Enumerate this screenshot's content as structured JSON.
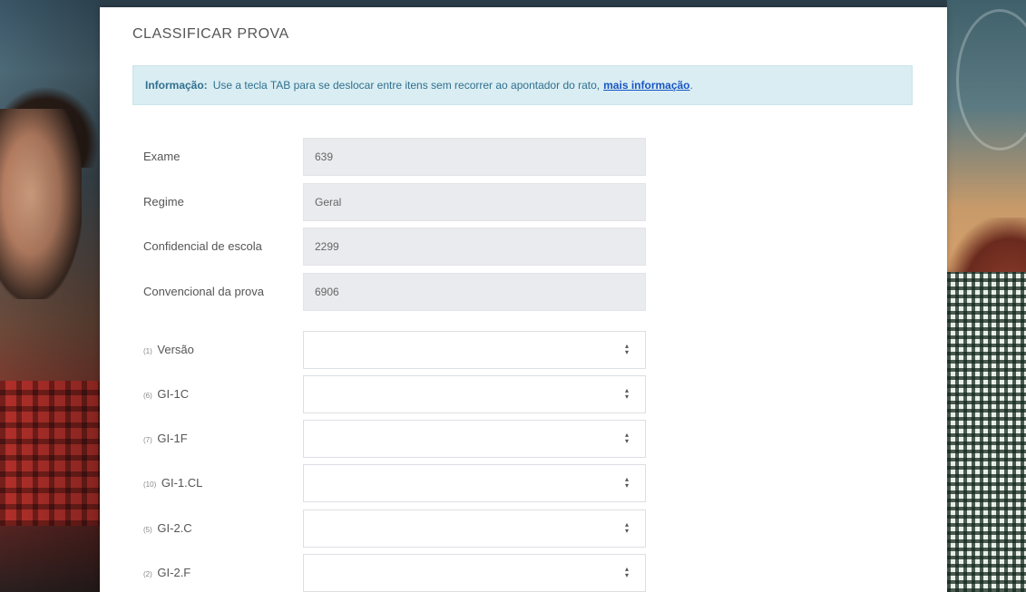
{
  "page_title": "CLASSIFICAR PROVA",
  "info": {
    "label": "Informação:",
    "message": "Use a tecla TAB para se deslocar entre itens sem recorrer ao apontador do rato,",
    "link": "mais informação",
    "suffix": "."
  },
  "readonly_fields": [
    {
      "label": "Exame",
      "value": "639"
    },
    {
      "label": "Regime",
      "value": "Geral"
    },
    {
      "label": "Confidencial de escola",
      "value": "2299"
    },
    {
      "label": "Convencional da prova",
      "value": "6906"
    }
  ],
  "select_fields": [
    {
      "index": "(1)",
      "label": "Versão",
      "value": ""
    },
    {
      "index": "(6)",
      "label": "GI-1C",
      "value": ""
    },
    {
      "index": "(7)",
      "label": "GI-1F",
      "value": ""
    },
    {
      "index": "(10)",
      "label": "GI-1.CL",
      "value": ""
    },
    {
      "index": "(5)",
      "label": "GI-2.C",
      "value": ""
    },
    {
      "index": "(2)",
      "label": "GI-2.F",
      "value": ""
    }
  ],
  "colors": {
    "alert_bg": "#d9edf2",
    "alert_text": "#31708f",
    "link": "#1a56c4",
    "readonly_bg": "#e9ebee"
  },
  "icons": {
    "select_arrows": "up-down-arrows-icon"
  }
}
